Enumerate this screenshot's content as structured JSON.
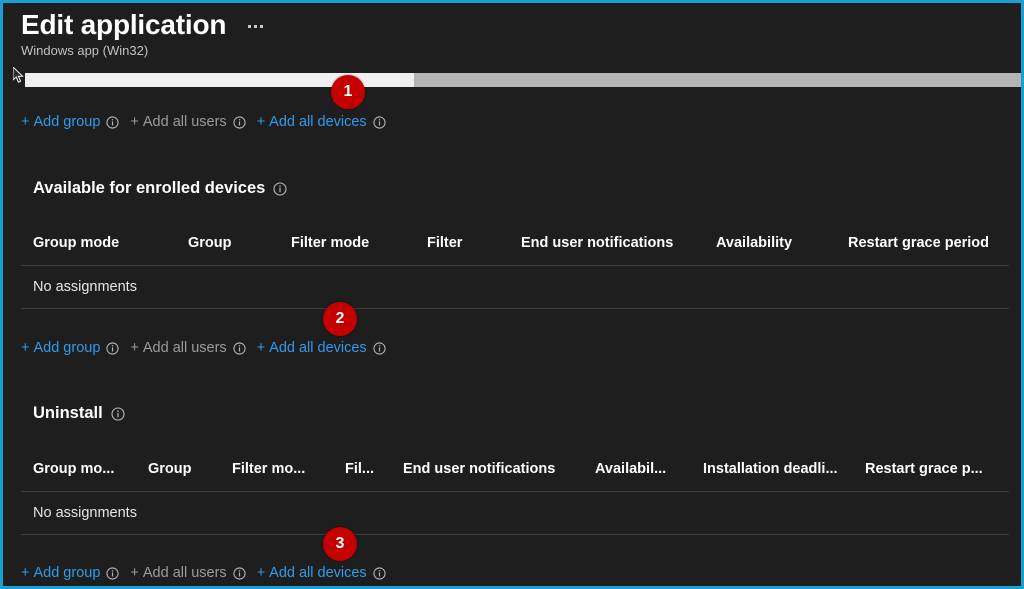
{
  "window": {
    "accent_border_color": "#1a9fd4",
    "background_color": "#1e1e1e"
  },
  "header": {
    "title": "Edit application",
    "subtitle": "Windows app (Win32)",
    "more_menu_label": "...",
    "more_menu_icon": "ellipsis-horizontal-icon"
  },
  "scrollbar": {
    "orientation": "horizontal",
    "thumb_percent": 39,
    "thumb_color": "#f0f0ee",
    "track_color": "#b4b4b4"
  },
  "link_labels": {
    "add_group": "Add group",
    "add_all_users": "Add all users",
    "add_all_devices": "Add all devices",
    "plus": "+",
    "info_icon": "info-circle-icon"
  },
  "link_rows": [
    {
      "badge": "1",
      "items": [
        {
          "label": "Add group",
          "state": "enabled"
        },
        {
          "label": "Add all users",
          "state": "disabled"
        },
        {
          "label": "Add all devices",
          "state": "enabled"
        }
      ]
    },
    {
      "badge": "2",
      "items": [
        {
          "label": "Add group",
          "state": "enabled"
        },
        {
          "label": "Add all users",
          "state": "disabled"
        },
        {
          "label": "Add all devices",
          "state": "enabled"
        }
      ]
    },
    {
      "badge": "3",
      "items": [
        {
          "label": "Add group",
          "state": "enabled"
        },
        {
          "label": "Add all users",
          "state": "disabled"
        },
        {
          "label": "Add all devices",
          "state": "enabled"
        }
      ]
    }
  ],
  "sections": [
    {
      "heading": "Available for enrolled devices",
      "info_icon": "info-circle-icon",
      "columns": [
        "Group mode",
        "Group",
        "Filter mode",
        "Filter",
        "End user notifications",
        "Availability",
        "Restart grace period"
      ],
      "empty_text": "No assignments"
    },
    {
      "heading": "Uninstall",
      "info_icon": "info-circle-icon",
      "columns": [
        "Group mo...",
        "Group",
        "Filter mo...",
        "Fil...",
        "End user notifications",
        "Availabil...",
        "Installation deadli...",
        "Restart grace p..."
      ],
      "empty_text": "No assignments"
    }
  ],
  "badges": {
    "color": "#c50000",
    "values": [
      "1",
      "2",
      "3"
    ]
  }
}
